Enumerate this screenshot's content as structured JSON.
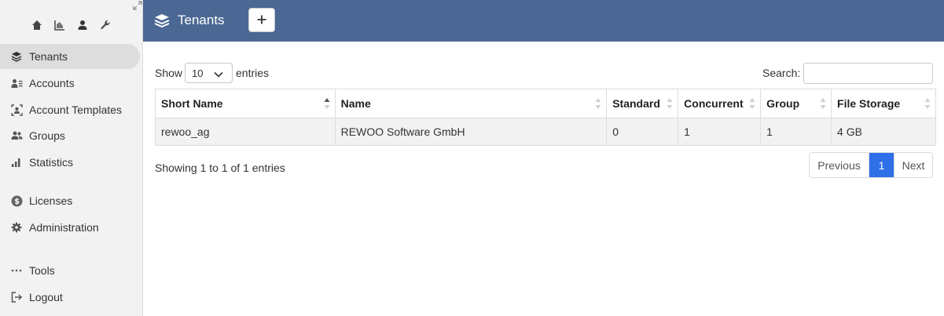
{
  "header": {
    "title": "Tenants",
    "add_icon": "plus-icon",
    "title_icon": "layers-icon"
  },
  "sidebar": {
    "top_icons": [
      "home-icon",
      "chart-area-icon",
      "user-icon",
      "wrench-icon"
    ],
    "items": [
      {
        "label": "Tenants",
        "icon": "layers-icon",
        "active": true
      },
      {
        "label": "Accounts",
        "icon": "user-list-icon"
      },
      {
        "label": "Account Templates",
        "icon": "user-frame-icon"
      },
      {
        "label": "Groups",
        "icon": "users-icon"
      },
      {
        "label": "Statistics",
        "icon": "bar-chart-icon"
      },
      {
        "label": "Licenses",
        "icon": "dollar-circle-icon"
      },
      {
        "label": "Administration",
        "icon": "gear-icon"
      },
      {
        "label": "Tools",
        "icon": "ellipsis-icon"
      },
      {
        "label": "Logout",
        "icon": "logout-icon"
      }
    ]
  },
  "controls": {
    "show_label": "Show",
    "page_length": "10",
    "entries_label": "entries",
    "search_label": "Search:",
    "search_value": ""
  },
  "table": {
    "columns": [
      "Short Name",
      "Name",
      "Standard",
      "Concurrent",
      "Group",
      "File Storage"
    ],
    "rows": [
      [
        "rewoo_ag",
        "REWOO Software GmbH",
        "0",
        "1",
        "1",
        "4 GB"
      ]
    ]
  },
  "info": "Showing 1 to 1 of 1 entries",
  "pagination": {
    "previous": "Previous",
    "current": "1",
    "next": "Next"
  },
  "colors": {
    "header_bg": "#4a6893",
    "active_page": "#2f6fe8",
    "sidebar_bg": "#f2f2f2"
  }
}
